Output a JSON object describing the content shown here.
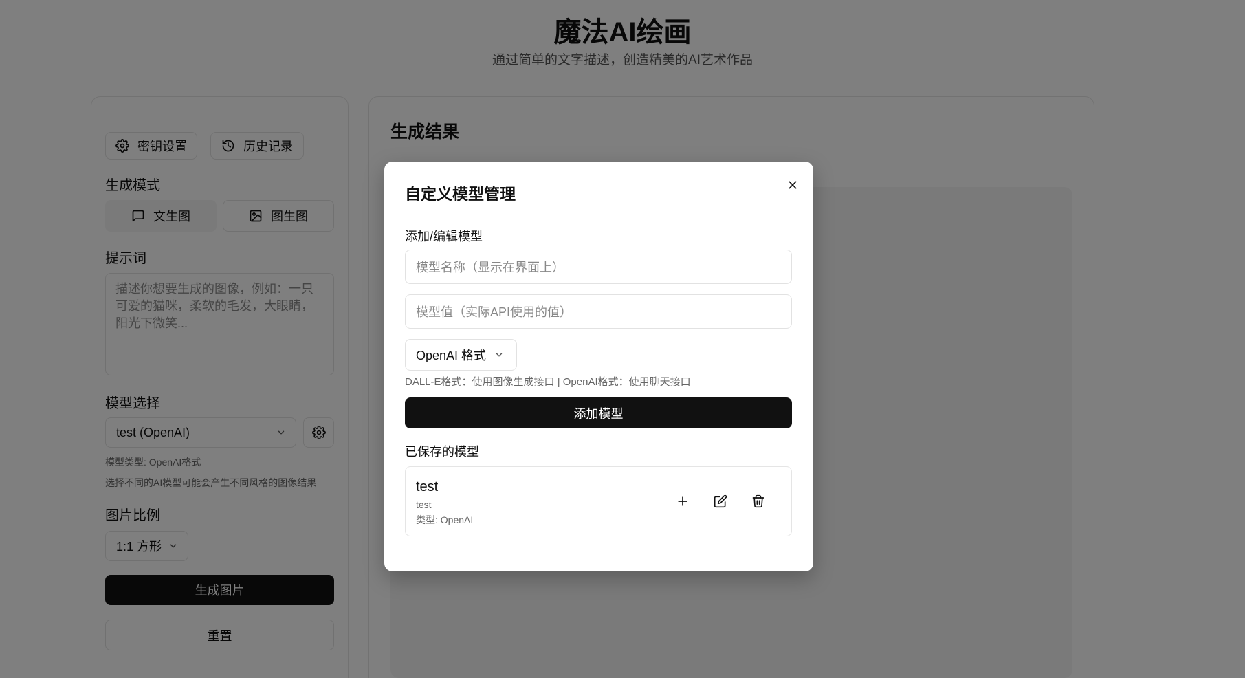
{
  "header": {
    "title": "魔法AI绘画",
    "subtitle": "通过简单的文字描述，创造精美的AI艺术作品"
  },
  "left": {
    "key_settings_label": "密钥设置",
    "history_label": "历史记录",
    "mode_label": "生成模式",
    "mode_text_to_image": "文生图",
    "mode_image_to_image": "图生图",
    "prompt_label": "提示词",
    "prompt_placeholder": "描述你想要生成的图像，例如：一只可爱的猫咪，柔软的毛发，大眼睛，阳光下微笑...",
    "model_label": "模型选择",
    "model_selected": "test (OpenAI)",
    "model_type_hint": "模型类型: OpenAI格式",
    "model_style_hint": "选择不同的AI模型可能会产生不同风格的图像结果",
    "ratio_label": "图片比例",
    "ratio_selected": "1:1 方形",
    "generate_label": "生成图片",
    "reset_label": "重置"
  },
  "right": {
    "title": "生成结果"
  },
  "modal": {
    "title": "自定义模型管理",
    "add_edit_label": "添加/编辑模型",
    "name_placeholder": "模型名称（显示在界面上）",
    "value_placeholder": "模型值（实际API使用的值）",
    "format_selected": "OpenAI 格式",
    "format_hint": "DALL-E格式：使用图像生成接口 | OpenAI格式：使用聊天接口",
    "add_button": "添加模型",
    "saved_label": "已保存的模型",
    "saved_models": [
      {
        "name": "test",
        "value": "test",
        "type": "类型: OpenAI"
      }
    ]
  },
  "colors": {
    "overlay": "rgba(0,0,0,0.5)",
    "primary_button": "#111111",
    "border": "#e2e2e2"
  }
}
